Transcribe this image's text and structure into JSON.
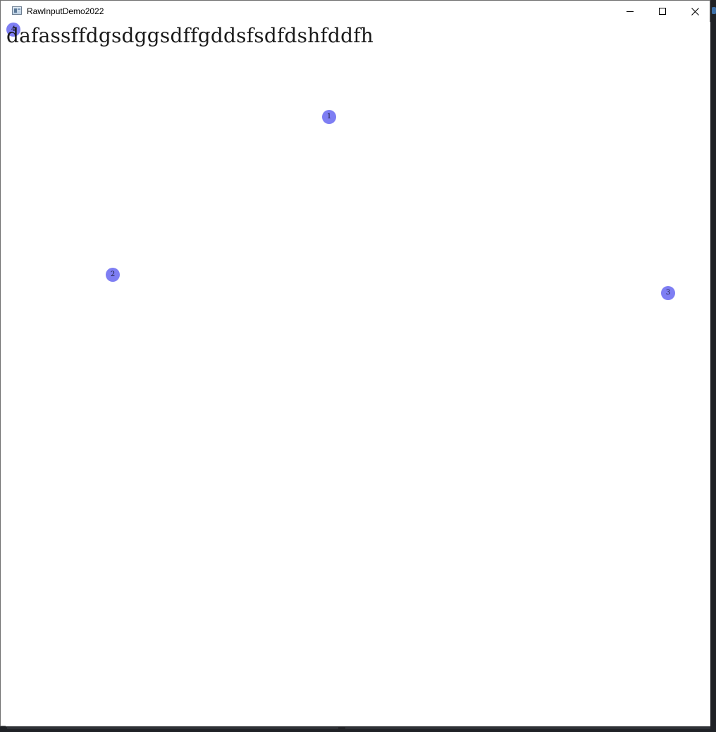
{
  "window": {
    "title": "RawInputDemo2022",
    "icon": "app-window-icon",
    "controls": {
      "minimize_icon": "minimize-icon",
      "maximize_icon": "maximize-icon",
      "close_icon": "close-icon"
    }
  },
  "client": {
    "typed_text": "dafassffdgsdggsdffgddsfsdfdshfddfh",
    "markers": [
      {
        "label": "1"
      },
      {
        "label": "2"
      },
      {
        "label": "3"
      },
      {
        "label": "4"
      }
    ]
  },
  "colors": {
    "marker_fill": "#7e7ef3",
    "window_background": "#ffffff",
    "desktop_background": "#1e2024"
  }
}
